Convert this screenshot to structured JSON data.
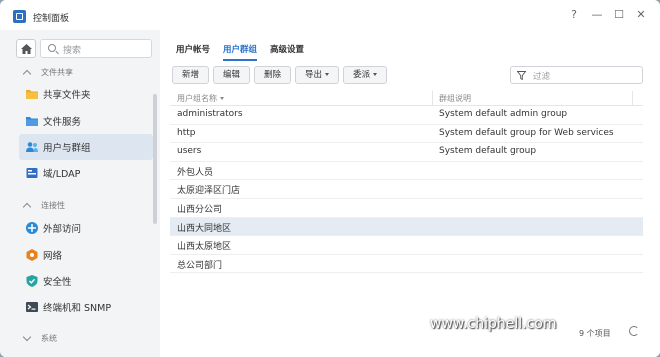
{
  "window": {
    "title": "控制面板"
  },
  "window_buttons": {
    "help": "?",
    "minimize": "—",
    "maximize": "☐",
    "close": "✕"
  },
  "sidebar": {
    "search_placeholder": "搜索",
    "sections": [
      {
        "label": "文件共享",
        "expanded": true
      },
      {
        "label": "连接性",
        "expanded": true
      },
      {
        "label": "系统",
        "expanded": false
      }
    ],
    "items": [
      {
        "label": "共享文件夹",
        "icon": "shared-folder-icon",
        "active": false
      },
      {
        "label": "文件服务",
        "icon": "file-services-icon",
        "active": false
      },
      {
        "label": "用户与群组",
        "icon": "users-groups-icon",
        "active": true
      },
      {
        "label": "域/LDAP",
        "icon": "domain-ldap-icon",
        "active": false
      },
      {
        "label": "外部访问",
        "icon": "external-access-icon",
        "active": false
      },
      {
        "label": "网络",
        "icon": "network-icon",
        "active": false
      },
      {
        "label": "安全性",
        "icon": "security-shield-icon",
        "active": false
      },
      {
        "label": "终端机和 SNMP",
        "icon": "terminal-icon",
        "active": false
      }
    ]
  },
  "tabs": [
    {
      "label": "用户帐号",
      "active": false
    },
    {
      "label": "用户群组",
      "active": true
    },
    {
      "label": "高级设置",
      "active": false
    }
  ],
  "toolbar": {
    "create": "新增",
    "edit": "编辑",
    "delete": "删除",
    "export": "导出",
    "delegate": "委派",
    "filter_placeholder": "过滤"
  },
  "table": {
    "columns": [
      "用户组名称",
      "群组说明"
    ],
    "rows": [
      {
        "name": "administrators",
        "desc": "System default admin group",
        "selected": false
      },
      {
        "name": "http",
        "desc": "System default group for Web services",
        "selected": false
      },
      {
        "name": "users",
        "desc": "System default group",
        "selected": false
      },
      {
        "name": "外包人员",
        "desc": "",
        "selected": false
      },
      {
        "name": "太原迎泽区门店",
        "desc": "",
        "selected": false
      },
      {
        "name": "山西分公司",
        "desc": "",
        "selected": false
      },
      {
        "name": "山西大同地区",
        "desc": "",
        "selected": true
      },
      {
        "name": "山西太原地区",
        "desc": "",
        "selected": false
      },
      {
        "name": "总公司部门",
        "desc": "",
        "selected": false
      }
    ]
  },
  "footer": {
    "count": "9 个项目"
  },
  "watermark": {
    "text": "www.chiphell.com",
    "logo": "chip hell"
  },
  "colors": {
    "accent": "#2b72c8",
    "selected_row": "#e4ebf3",
    "sidebar_bg": "#f3f4f6"
  }
}
